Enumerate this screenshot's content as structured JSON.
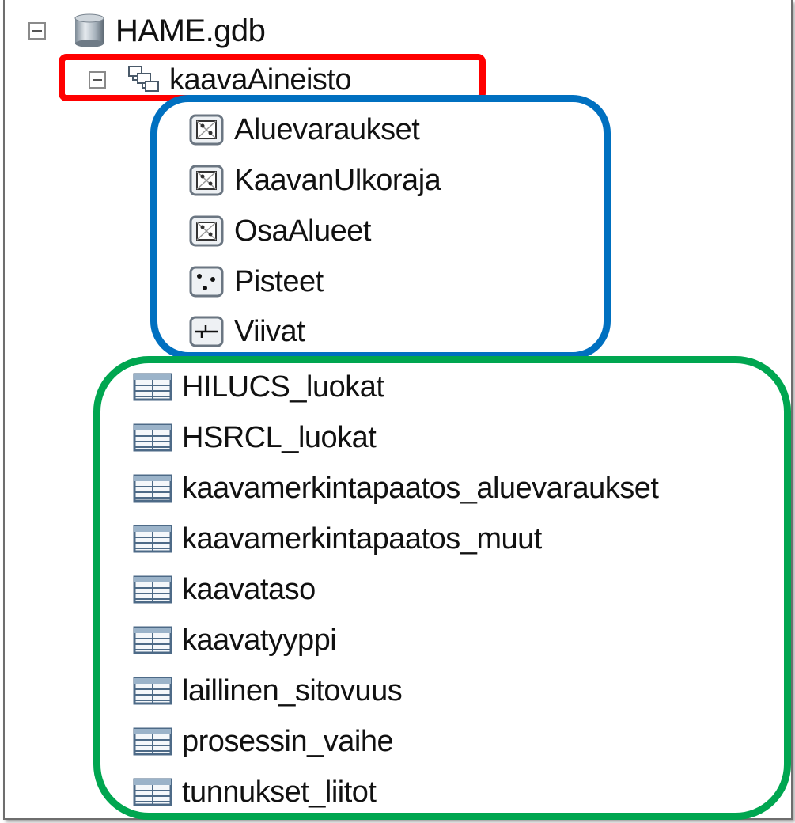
{
  "tree": {
    "root": {
      "label": "HAME.gdb",
      "icon": "geodatabase-icon",
      "expanded": true
    },
    "dataset": {
      "label": "kaavaAineisto",
      "icon": "feature-dataset-icon",
      "expanded": true
    },
    "feature_classes": [
      {
        "label": "Aluevaraukset",
        "icon": "polygon-feature-class-icon"
      },
      {
        "label": "KaavanUlkoraja",
        "icon": "polygon-feature-class-icon"
      },
      {
        "label": "OsaAlueet",
        "icon": "polygon-feature-class-icon"
      },
      {
        "label": "Pisteet",
        "icon": "point-feature-class-icon"
      },
      {
        "label": "Viivat",
        "icon": "line-feature-class-icon"
      }
    ],
    "tables": [
      {
        "label": "HILUCS_luokat",
        "icon": "table-icon"
      },
      {
        "label": "HSRCL_luokat",
        "icon": "table-icon"
      },
      {
        "label": "kaavamerkintapaatos_aluevaraukset",
        "icon": "table-icon"
      },
      {
        "label": "kaavamerkintapaatos_muut",
        "icon": "table-icon"
      },
      {
        "label": "kaavataso",
        "icon": "table-icon"
      },
      {
        "label": "kaavatyyppi",
        "icon": "table-icon"
      },
      {
        "label": "laillinen_sitovuus",
        "icon": "table-icon"
      },
      {
        "label": "prosessin_vaihe",
        "icon": "table-icon"
      },
      {
        "label": "tunnukset_liitot",
        "icon": "table-icon"
      }
    ]
  },
  "highlights": {
    "dataset_color": "#ff0000",
    "feature_classes_color": "#0070c0",
    "tables_color": "#00a650"
  }
}
